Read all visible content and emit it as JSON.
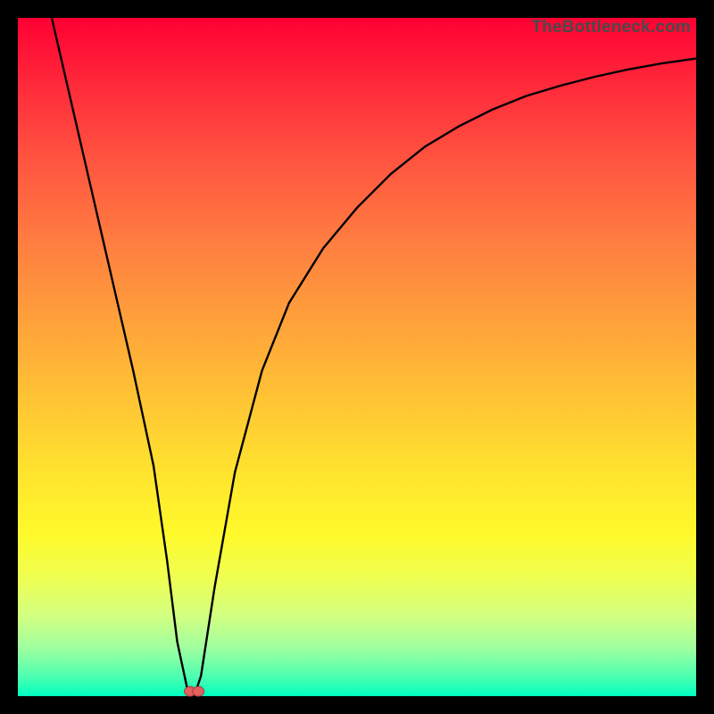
{
  "watermark": "TheBottleneck.com",
  "chart_data": {
    "type": "line",
    "title": "",
    "xlabel": "",
    "ylabel": "",
    "xlim": [
      0,
      100
    ],
    "ylim": [
      0,
      100
    ],
    "grid": false,
    "series": [
      {
        "name": "bottleneck-curve",
        "x": [
          5,
          8,
          11,
          14,
          17,
          20,
          22,
          23.5,
          25,
          26,
          27,
          29,
          32,
          36,
          40,
          45,
          50,
          55,
          60,
          65,
          70,
          75,
          80,
          85,
          90,
          95,
          100
        ],
        "values": [
          100,
          87,
          74,
          61,
          48,
          34,
          20,
          8,
          1,
          0,
          3,
          16,
          33,
          48,
          58,
          66,
          72,
          77,
          81,
          84,
          86.5,
          88.5,
          90,
          91.3,
          92.4,
          93.3,
          94
        ]
      }
    ],
    "markers": [
      {
        "name": "optimal-point-a",
        "x": 25.4,
        "y": 0.7
      },
      {
        "name": "optimal-point-b",
        "x": 26.6,
        "y": 0.7
      }
    ],
    "background_gradient": {
      "top": "#ff0033",
      "upper_mid": "#ffa53a",
      "lower_mid": "#fff92a",
      "bottom": "#00ffc0"
    }
  }
}
